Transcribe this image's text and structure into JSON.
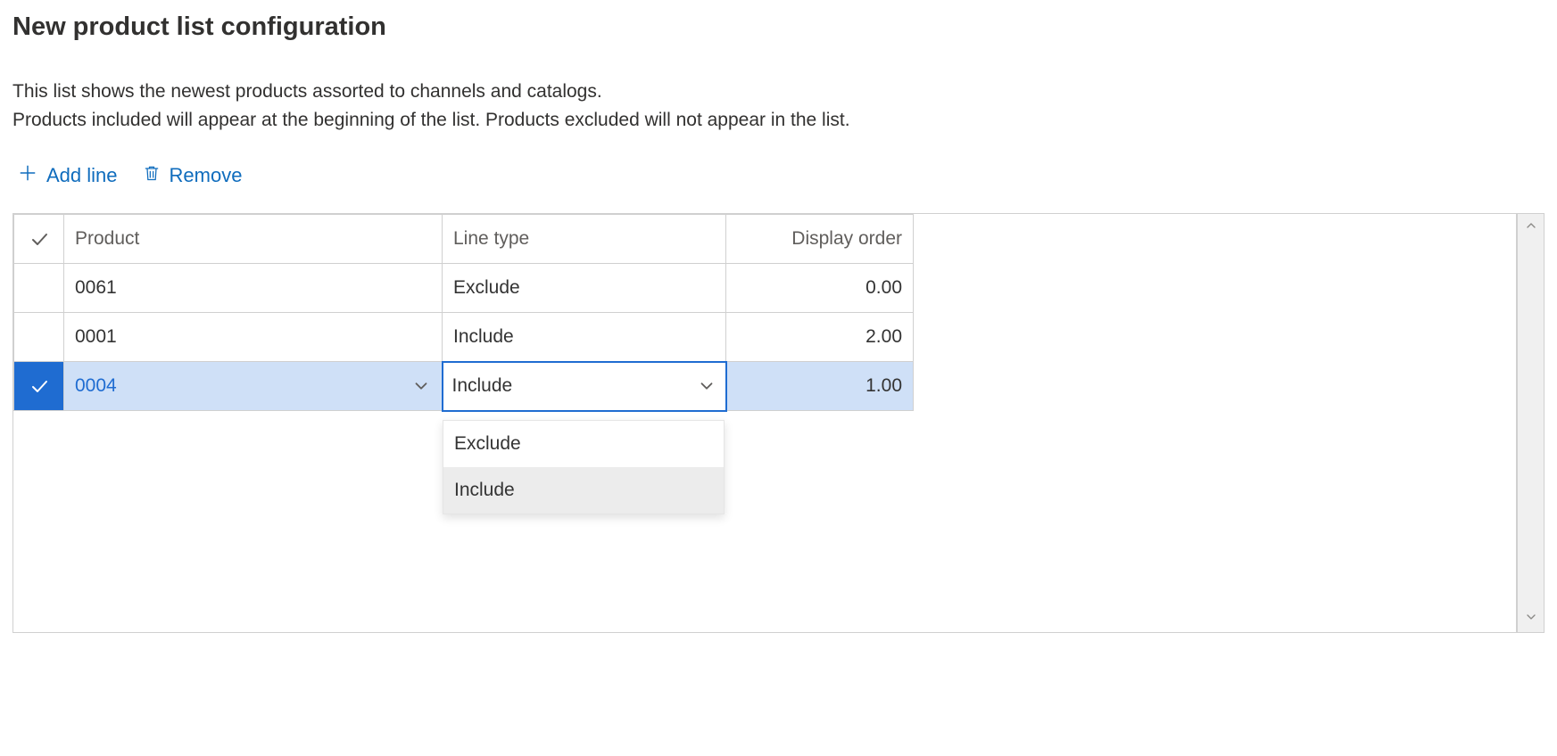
{
  "title": "New product list configuration",
  "description_line1": "This list shows the newest products assorted to channels and catalogs.",
  "description_line2": "Products included will appear at the beginning of the list. Products excluded will not appear in the list.",
  "toolbar": {
    "add_line_label": "Add line",
    "remove_label": "Remove"
  },
  "grid": {
    "columns": {
      "product": "Product",
      "line_type": "Line type",
      "display_order": "Display order"
    },
    "rows": [
      {
        "product": "0061",
        "line_type": "Exclude",
        "display_order": "0.00",
        "selected": false
      },
      {
        "product": "0001",
        "line_type": "Include",
        "display_order": "2.00",
        "selected": false
      },
      {
        "product": "0004",
        "line_type": "Include",
        "display_order": "1.00",
        "selected": true
      }
    ],
    "dropdown": {
      "options": [
        "Exclude",
        "Include"
      ],
      "highlighted": "Include"
    }
  },
  "colors": {
    "accent": "#0f6cbd",
    "selection_bg": "#cfe0f7",
    "selection_check_bg": "#1f6cd1"
  }
}
